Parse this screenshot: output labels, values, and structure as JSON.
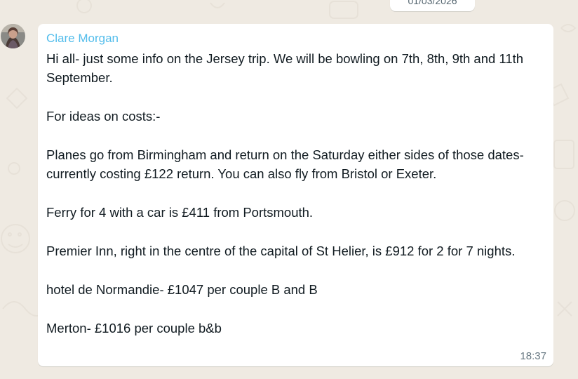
{
  "date_divider": "01/03/2026",
  "message": {
    "sender": "Clare Morgan",
    "sender_color": "#53bdeb",
    "time": "18:37",
    "paragraphs": [
      "Hi all- just some info on the Jersey trip. We will be bowling on 7th, 8th, 9th and 11th September.",
      "For ideas on costs:-",
      "Planes go from Birmingham and return on the Saturday either sides of those dates- currently costing £122 return. You can also fly from Bristol or Exeter.",
      "Ferry for 4 with a car is £411 from Portsmouth.",
      "Premier Inn, right in the centre of the capital of St Helier, is £912 for 2 for 7 nights.",
      "hotel de Normandie- £1047 per couple B and B",
      "Merton- £1016 per couple b&b"
    ]
  },
  "colors": {
    "chat_background": "#efeae2",
    "bubble_background": "#ffffff",
    "text": "#111b21",
    "meta_text": "#667781"
  }
}
